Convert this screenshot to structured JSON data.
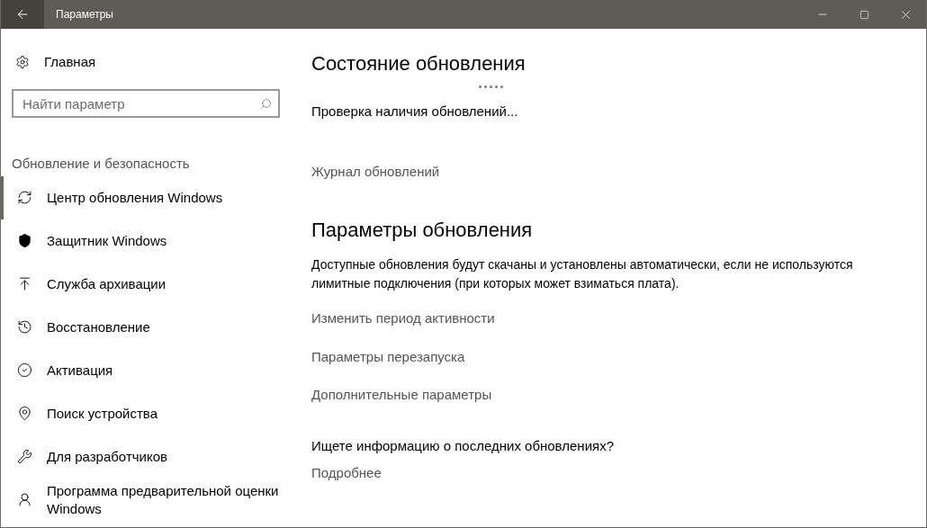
{
  "window": {
    "title": "Параметры"
  },
  "sidebar": {
    "home": "Главная",
    "search": {
      "placeholder": "Найти параметр"
    },
    "section": "Обновление и безопасность",
    "items": [
      {
        "kind": "sync",
        "label": "Центр обновления Windows",
        "selected": true
      },
      {
        "kind": "shield",
        "label": "Защитник Windows",
        "selected": false
      },
      {
        "kind": "backup",
        "label": "Служба архивации",
        "selected": false
      },
      {
        "kind": "history",
        "label": "Восстановление",
        "selected": false
      },
      {
        "kind": "check",
        "label": "Активация",
        "selected": false
      },
      {
        "kind": "locate",
        "label": "Поиск устройства",
        "selected": false
      },
      {
        "kind": "tools",
        "label": "Для разработчиков",
        "selected": false
      },
      {
        "kind": "insider",
        "label": "Программа предварительной оценки Windows",
        "selected": false
      }
    ]
  },
  "update_status": {
    "title": "Состояние обновления",
    "status": "Проверка наличия обновлений...",
    "links": [
      "Журнал обновлений"
    ]
  },
  "update_settings": {
    "title": "Параметры обновления",
    "description": "Доступные обновления будут скачаны и установлены автоматически, если не используются лимитные подключения (при которых может взиматься плата).",
    "links": [
      "Изменить период активности",
      "Параметры перезапуска",
      "Дополнительные параметры"
    ],
    "info_question": "Ищете информацию о последних обновлениях?",
    "info_link": "Подробнее"
  }
}
